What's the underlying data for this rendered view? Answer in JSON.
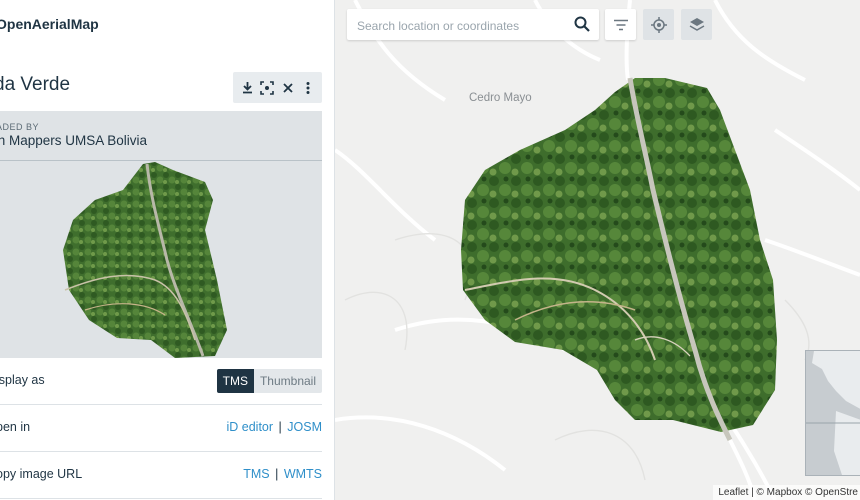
{
  "app": {
    "brand": "OpenAerialMap"
  },
  "image": {
    "title": "da Verde",
    "uploaded_label": "ADED BY",
    "uploader": "th Mappers UMSA Bolivia"
  },
  "toolbar": {
    "icons": [
      "download-icon",
      "focus-icon",
      "close-icon",
      "more-vertical-icon"
    ]
  },
  "rows": {
    "display": {
      "label": "isplay as",
      "options": [
        "TMS",
        "Thumbnail"
      ],
      "selected": "TMS"
    },
    "open": {
      "label": "pen in",
      "link1": "iD editor",
      "sep": "|",
      "link2": "JOSM"
    },
    "copy": {
      "label": "opy image URL",
      "link1": "TMS",
      "sep": "|",
      "link2": "WMTS"
    }
  },
  "map": {
    "search_placeholder": "Search location or coordinates",
    "place_label": "Cedro Mayo",
    "attribution": "Leaflet | © Mapbox © OpenStre",
    "buttons": [
      "filter-icon",
      "locate-icon",
      "layers-icon"
    ]
  },
  "colors": {
    "accent": "#1f3443",
    "link": "#2f8fc9",
    "imagery_green": "#3c6b2c"
  }
}
